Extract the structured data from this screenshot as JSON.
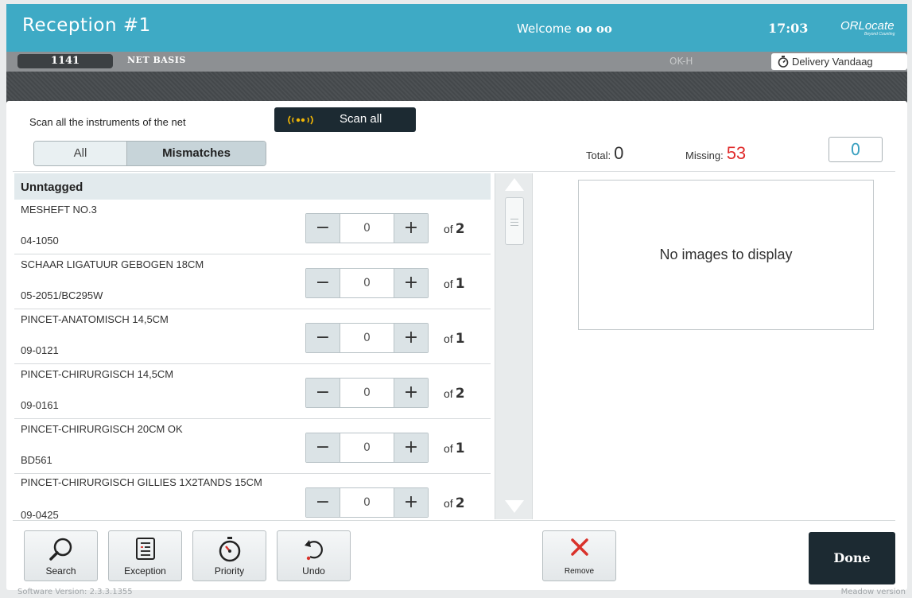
{
  "header": {
    "title": "Reception #1",
    "welcome_label": "Welcome",
    "user": "oo oo",
    "time": "17:03",
    "logo": "ORLocate",
    "logo_tagline": "Beyond Counting"
  },
  "subbar": {
    "net_id": "1141",
    "net_name": "NET BASIS",
    "location": "OK-H",
    "delivery": "Delivery Vandaag"
  },
  "scan": {
    "instruction": "Scan all the instruments of the net",
    "button": "Scan all"
  },
  "filter": {
    "all": "All",
    "mismatches": "Mismatches",
    "selected": "Mismatches"
  },
  "stats": {
    "total_label": "Total:",
    "total": "0",
    "missing_label": "Missing:",
    "missing": "53",
    "count": "0"
  },
  "list": {
    "group": "Unntagged",
    "of_label": "of",
    "items": [
      {
        "name": "MESHEFT NO.3",
        "code": "04-1050",
        "count": "0",
        "expected": "2"
      },
      {
        "name": "SCHAAR LIGATUUR GEBOGEN 18CM",
        "code": "05-2051/BC295W",
        "count": "0",
        "expected": "1"
      },
      {
        "name": "PINCET-ANATOMISCH 14,5CM",
        "code": "09-0121",
        "count": "0",
        "expected": "1"
      },
      {
        "name": "PINCET-CHIRURGISCH 14,5CM",
        "code": "09-0161",
        "count": "0",
        "expected": "2"
      },
      {
        "name": "PINCET-CHIRURGISCH 20CM OK",
        "code": "BD561",
        "count": "0",
        "expected": "1"
      },
      {
        "name": "PINCET-CHIRURGISCH GILLIES 1X2TANDS 15CM",
        "code": "09-0425",
        "count": "0",
        "expected": "2"
      }
    ]
  },
  "images": {
    "empty_text": "No images to display"
  },
  "toolbar": {
    "search": "Search",
    "exception": "Exception",
    "priority": "Priority",
    "undo": "Undo",
    "remove": "Remove",
    "done": "Done"
  },
  "footer": {
    "version": "Software Version: 2.3.3.1355",
    "right": "Meadow version"
  },
  "colors": {
    "header": "#3eaac5",
    "dark_button": "#1c2a32",
    "missing": "#e02b2b",
    "remove_icon": "#d9322b"
  }
}
